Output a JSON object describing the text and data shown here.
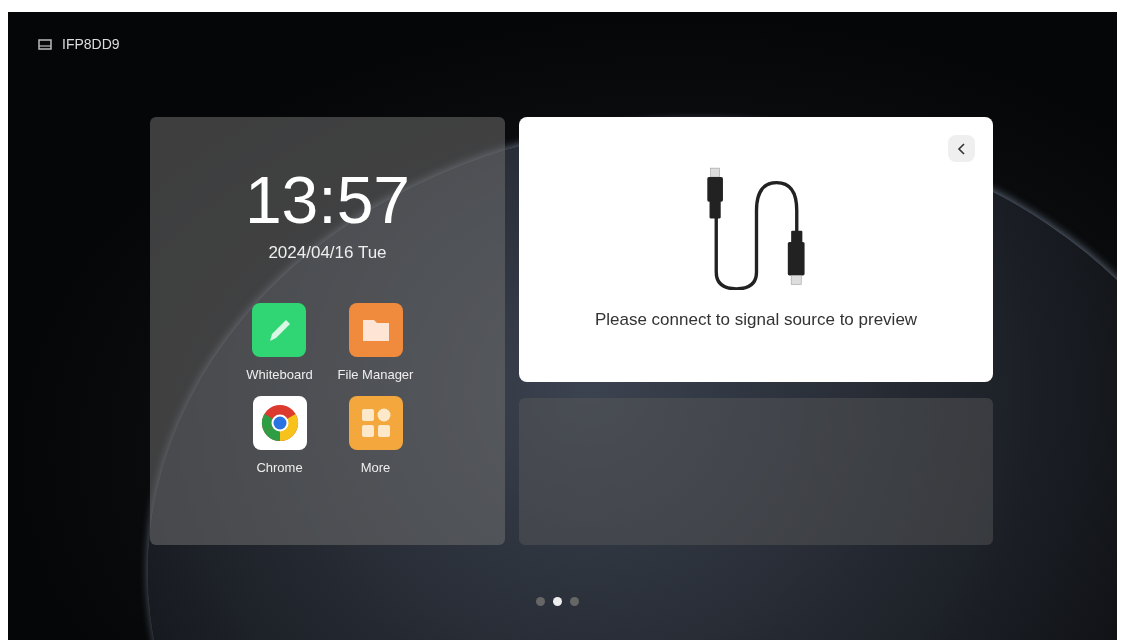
{
  "status_bar": {
    "device_name": "IFP8DD9"
  },
  "clock": {
    "time": "13:57",
    "date": "2024/04/16 Tue"
  },
  "apps": [
    {
      "label": "Whiteboard",
      "kind": "whiteboard"
    },
    {
      "label": "File Manager",
      "kind": "files"
    },
    {
      "label": "Chrome",
      "kind": "browser"
    },
    {
      "label": "More",
      "kind": "more"
    }
  ],
  "preview": {
    "message": "Please connect to signal source to preview"
  },
  "pages": [
    {
      "selected": false
    },
    {
      "selected": true
    },
    {
      "selected": false
    }
  ]
}
